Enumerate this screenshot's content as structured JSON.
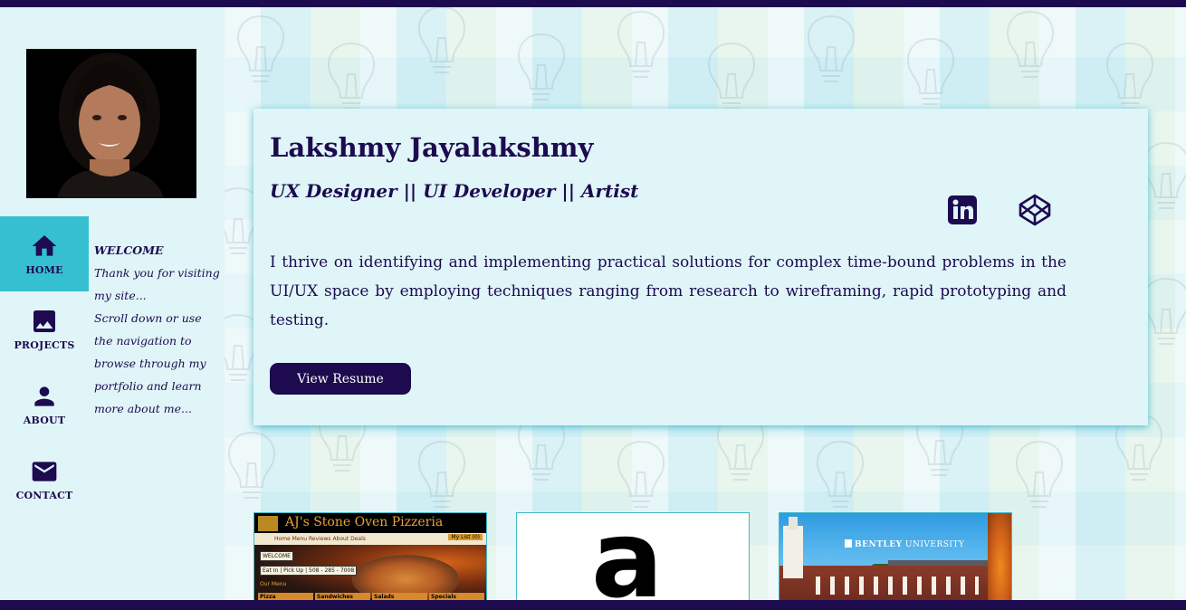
{
  "sidebar": {
    "nav": [
      {
        "label": "HOME",
        "icon": "home-icon",
        "active": true
      },
      {
        "label": "PROJECTS",
        "icon": "image-icon",
        "active": false
      },
      {
        "label": "ABOUT",
        "icon": "person-icon",
        "active": false
      },
      {
        "label": "CONTACT",
        "icon": "mail-icon",
        "active": false
      }
    ],
    "welcome": {
      "title": "WELCOME",
      "lines": [
        "Thank you for visiting my site...",
        "Scroll down or use the navigation to browse through my portfolio and learn more about me..."
      ]
    }
  },
  "profile": {
    "name": "Lakshmy Jayalakshmy",
    "tagline": "UX Designer || UI Developer || Artist",
    "bio": "I thrive on identifying and implementing practical solutions for complex time-bound problems in the UI/UX space by employing techniques ranging from research to wireframing, rapid prototyping and testing.",
    "resume_label": "View Resume",
    "social": [
      {
        "icon": "linkedin-icon"
      },
      {
        "icon": "codepen-icon"
      }
    ]
  },
  "projects": {
    "pizza": {
      "title": "AJ's Stone Oven Pizzeria",
      "nav": "Home   Menu   Reviews   About   Deals",
      "cart": "My List (0)",
      "welcome": "WELCOME",
      "order": "Eat In | Pick Up | 508 - 285 - 7008",
      "menu": "Our Menu",
      "tabs": [
        "Pizza",
        "Sandwiches",
        "Salads",
        "Specials"
      ]
    },
    "amazon": {
      "letter": "a"
    },
    "bentley": {
      "brand": "BENTLEY",
      "suffix": "UNIVERSITY"
    }
  },
  "colors": {
    "primary": "#1d0a4f",
    "accent": "#36bfd0",
    "card": "#dff5f8"
  }
}
